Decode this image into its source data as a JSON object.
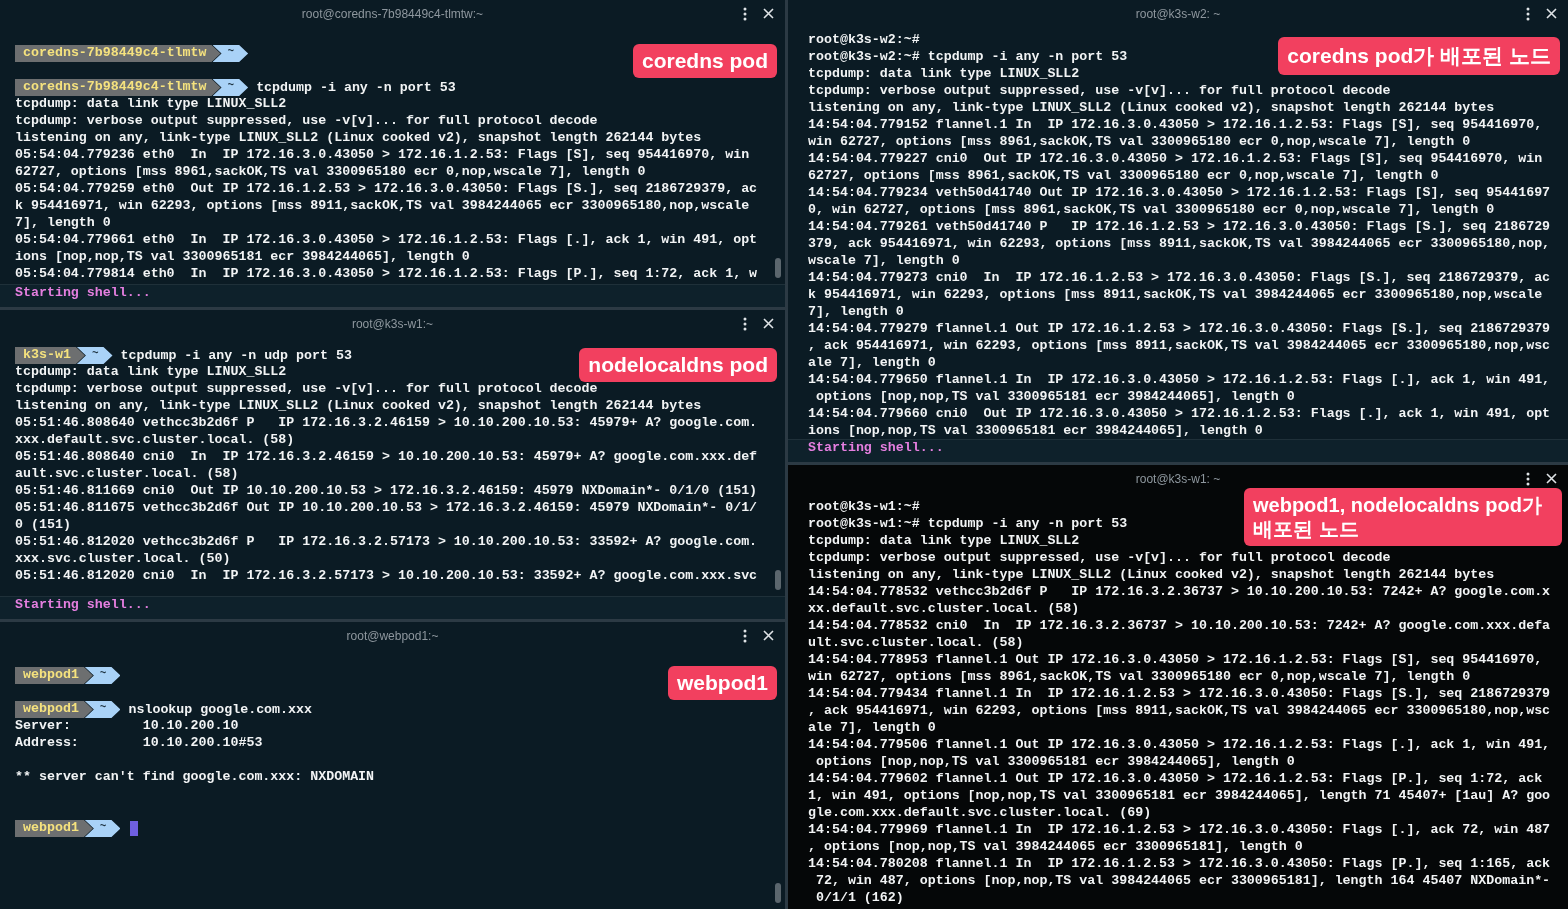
{
  "left_column": {
    "panes": [
      {
        "title": "root@coredns-7b98449c4-tlmtw:~",
        "label": "coredns pod",
        "status": "Starting shell...",
        "lines": [
          {
            "kind": "blank"
          },
          {
            "kind": "prompt",
            "host": "coredns-7b98449c4-tlmtw",
            "dir": "~"
          },
          {
            "kind": "blank"
          },
          {
            "kind": "prompt",
            "host": "coredns-7b98449c4-tlmtw",
            "dir": "~",
            "command": "tcpdump -i any -n port 53"
          },
          {
            "kind": "text",
            "text": "tcpdump: data link type LINUX_SLL2"
          },
          {
            "kind": "text",
            "text": "tcpdump: verbose output suppressed, use -v[v]... for full protocol decode"
          },
          {
            "kind": "text",
            "text": "listening on any, link-type LINUX_SLL2 (Linux cooked v2), snapshot length 262144 bytes"
          },
          {
            "kind": "text",
            "text": "05:54:04.779236 eth0  In  IP 172.16.3.0.43050 > 172.16.1.2.53: Flags [S], seq 954416970, win"
          },
          {
            "kind": "text",
            "text": "62727, options [mss 8961,sackOK,TS val 3300965180 ecr 0,nop,wscale 7], length 0"
          },
          {
            "kind": "text",
            "text": "05:54:04.779259 eth0  Out IP 172.16.1.2.53 > 172.16.3.0.43050: Flags [S.], seq 2186729379, ac"
          },
          {
            "kind": "text",
            "text": "k 954416971, win 62293, options [mss 8911,sackOK,TS val 3984244065 ecr 3300965180,nop,wscale"
          },
          {
            "kind": "text",
            "text": "7], length 0"
          },
          {
            "kind": "text",
            "text": "05:54:04.779661 eth0  In  IP 172.16.3.0.43050 > 172.16.1.2.53: Flags [.], ack 1, win 491, opt"
          },
          {
            "kind": "text",
            "text": "ions [nop,nop,TS val 3300965181 ecr 3984244065], length 0"
          },
          {
            "kind": "text",
            "text": "05:54:04.779814 eth0  In  IP 172.16.3.0.43050 > 172.16.1.2.53: Flags [P.], seq 1:72, ack 1, w"
          }
        ]
      },
      {
        "title": "root@k3s-w1:~",
        "label": "nodelocaldns pod",
        "status": "Starting shell...",
        "lines": [
          {
            "kind": "prompt",
            "host": "k3s-w1",
            "dir": "~",
            "command": "tcpdump -i any -n udp port 53"
          },
          {
            "kind": "text",
            "text": "tcpdump: data link type LINUX_SLL2"
          },
          {
            "kind": "text",
            "text": "tcpdump: verbose output suppressed, use -v[v]... for full protocol decode"
          },
          {
            "kind": "text",
            "text": "listening on any, link-type LINUX_SLL2 (Linux cooked v2), snapshot length 262144 bytes"
          },
          {
            "kind": "text",
            "text": "05:51:46.808640 vethcc3b2d6f P   IP 172.16.3.2.46159 > 10.10.200.10.53: 45979+ A? google.com."
          },
          {
            "kind": "text",
            "text": "xxx.default.svc.cluster.local. (58)"
          },
          {
            "kind": "text",
            "text": "05:51:46.808640 cni0  In  IP 172.16.3.2.46159 > 10.10.200.10.53: 45979+ A? google.com.xxx.def"
          },
          {
            "kind": "text",
            "text": "ault.svc.cluster.local. (58)"
          },
          {
            "kind": "text",
            "text": "05:51:46.811669 cni0  Out IP 10.10.200.10.53 > 172.16.3.2.46159: 45979 NXDomain*- 0/1/0 (151)"
          },
          {
            "kind": "text",
            "text": "05:51:46.811675 vethcc3b2d6f Out IP 10.10.200.10.53 > 172.16.3.2.46159: 45979 NXDomain*- 0/1/"
          },
          {
            "kind": "text",
            "text": "0 (151)"
          },
          {
            "kind": "text",
            "text": "05:51:46.812020 vethcc3b2d6f P   IP 172.16.3.2.57173 > 10.10.200.10.53: 33592+ A? google.com."
          },
          {
            "kind": "text",
            "text": "xxx.svc.cluster.local. (50)"
          },
          {
            "kind": "text",
            "text": "05:51:46.812020 cni0  In  IP 172.16.3.2.57173 > 10.10.200.10.53: 33592+ A? google.com.xxx.svc"
          }
        ]
      },
      {
        "title": "root@webpod1:~",
        "label": "webpod1",
        "lines": [
          {
            "kind": "blank"
          },
          {
            "kind": "prompt",
            "host": "webpod1",
            "dir": "~"
          },
          {
            "kind": "blank"
          },
          {
            "kind": "prompt",
            "host": "webpod1",
            "dir": "~",
            "command": "nslookup google.com.xxx"
          },
          {
            "kind": "text",
            "text": "Server:         10.10.200.10"
          },
          {
            "kind": "text",
            "text": "Address:        10.10.200.10#53"
          },
          {
            "kind": "blank"
          },
          {
            "kind": "text",
            "text": "** server can't find google.com.xxx: NXDOMAIN"
          },
          {
            "kind": "blank"
          },
          {
            "kind": "blank"
          },
          {
            "kind": "prompt",
            "host": "webpod1",
            "dir": "~",
            "cursor": true
          }
        ]
      }
    ]
  },
  "right_column": {
    "panes": [
      {
        "title": "root@k3s-w2: ~",
        "label": "coredns pod가 배포된 노드",
        "status": "Starting shell...",
        "lines": [
          {
            "kind": "text",
            "text": "root@k3s-w2:~#"
          },
          {
            "kind": "text",
            "text": "root@k3s-w2:~# tcpdump -i any -n port 53"
          },
          {
            "kind": "text",
            "text": "tcpdump: data link type LINUX_SLL2"
          },
          {
            "kind": "text",
            "text": "tcpdump: verbose output suppressed, use -v[v]... for full protocol decode"
          },
          {
            "kind": "text",
            "text": "listening on any, link-type LINUX_SLL2 (Linux cooked v2), snapshot length 262144 bytes"
          },
          {
            "kind": "text",
            "text": "14:54:04.779152 flannel.1 In  IP 172.16.3.0.43050 > 172.16.1.2.53: Flags [S], seq 954416970,"
          },
          {
            "kind": "text",
            "text": "win 62727, options [mss 8961,sackOK,TS val 3300965180 ecr 0,nop,wscale 7], length 0"
          },
          {
            "kind": "text",
            "text": "14:54:04.779227 cni0  Out IP 172.16.3.0.43050 > 172.16.1.2.53: Flags [S], seq 954416970, win"
          },
          {
            "kind": "text",
            "text": "62727, options [mss 8961,sackOK,TS val 3300965180 ecr 0,nop,wscale 7], length 0"
          },
          {
            "kind": "text",
            "text": "14:54:04.779234 veth50d41740 Out IP 172.16.3.0.43050 > 172.16.1.2.53: Flags [S], seq 95441697"
          },
          {
            "kind": "text",
            "text": "0, win 62727, options [mss 8961,sackOK,TS val 3300965180 ecr 0,nop,wscale 7], length 0"
          },
          {
            "kind": "text",
            "text": "14:54:04.779261 veth50d41740 P   IP 172.16.1.2.53 > 172.16.3.0.43050: Flags [S.], seq 2186729"
          },
          {
            "kind": "text",
            "text": "379, ack 954416971, win 62293, options [mss 8911,sackOK,TS val 3984244065 ecr 3300965180,nop,"
          },
          {
            "kind": "text",
            "text": "wscale 7], length 0"
          },
          {
            "kind": "text",
            "text": "14:54:04.779273 cni0  In  IP 172.16.1.2.53 > 172.16.3.0.43050: Flags [S.], seq 2186729379, ac"
          },
          {
            "kind": "text",
            "text": "k 954416971, win 62293, options [mss 8911,sackOK,TS val 3984244065 ecr 3300965180,nop,wscale"
          },
          {
            "kind": "text",
            "text": "7], length 0"
          },
          {
            "kind": "text",
            "text": "14:54:04.779279 flannel.1 Out IP 172.16.1.2.53 > 172.16.3.0.43050: Flags [S.], seq 2186729379"
          },
          {
            "kind": "text",
            "text": ", ack 954416971, win 62293, options [mss 8911,sackOK,TS val 3984244065 ecr 3300965180,nop,wsc"
          },
          {
            "kind": "text",
            "text": "ale 7], length 0"
          },
          {
            "kind": "text",
            "text": "14:54:04.779650 flannel.1 In  IP 172.16.3.0.43050 > 172.16.1.2.53: Flags [.], ack 1, win 491,"
          },
          {
            "kind": "text",
            "text": " options [nop,nop,TS val 3300965181 ecr 3984244065], length 0"
          },
          {
            "kind": "text",
            "text": "14:54:04.779660 cni0  Out IP 172.16.3.0.43050 > 172.16.1.2.53: Flags [.], ack 1, win 491, opt"
          },
          {
            "kind": "text",
            "text": "ions [nop,nop,TS val 3300965181 ecr 3984244065], length 0"
          }
        ]
      },
      {
        "title": "root@k3s-w1: ~",
        "label": "webpod1, nodelocaldns pod가 배포된 노드",
        "lines": [
          {
            "kind": "text",
            "text": "root@k3s-w1:~#"
          },
          {
            "kind": "text",
            "text": "root@k3s-w1:~# tcpdump -i any -n port 53"
          },
          {
            "kind": "text",
            "text": "tcpdump: data link type LINUX_SLL2"
          },
          {
            "kind": "text",
            "text": "tcpdump: verbose output suppressed, use -v[v]... for full protocol decode"
          },
          {
            "kind": "text",
            "text": "listening on any, link-type LINUX_SLL2 (Linux cooked v2), snapshot length 262144 bytes"
          },
          {
            "kind": "text",
            "text": "14:54:04.778532 vethcc3b2d6f P   IP 172.16.3.2.36737 > 10.10.200.10.53: 7242+ A? google.com.x"
          },
          {
            "kind": "text",
            "text": "xx.default.svc.cluster.local. (58)"
          },
          {
            "kind": "text",
            "text": "14:54:04.778532 cni0  In  IP 172.16.3.2.36737 > 10.10.200.10.53: 7242+ A? google.com.xxx.defa"
          },
          {
            "kind": "text",
            "text": "ult.svc.cluster.local. (58)"
          },
          {
            "kind": "text",
            "text": "14:54:04.778953 flannel.1 Out IP 172.16.3.0.43050 > 172.16.1.2.53: Flags [S], seq 954416970,"
          },
          {
            "kind": "text",
            "text": "win 62727, options [mss 8961,sackOK,TS val 3300965180 ecr 0,nop,wscale 7], length 0"
          },
          {
            "kind": "text",
            "text": "14:54:04.779434 flannel.1 In  IP 172.16.1.2.53 > 172.16.3.0.43050: Flags [S.], seq 2186729379"
          },
          {
            "kind": "text",
            "text": ", ack 954416971, win 62293, options [mss 8911,sackOK,TS val 3984244065 ecr 3300965180,nop,wsc"
          },
          {
            "kind": "text",
            "text": "ale 7], length 0"
          },
          {
            "kind": "text",
            "text": "14:54:04.779506 flannel.1 Out IP 172.16.3.0.43050 > 172.16.1.2.53: Flags [.], ack 1, win 491,"
          },
          {
            "kind": "text",
            "text": " options [nop,nop,TS val 3300965181 ecr 3984244065], length 0"
          },
          {
            "kind": "text",
            "text": "14:54:04.779602 flannel.1 Out IP 172.16.3.0.43050 > 172.16.1.2.53: Flags [P.], seq 1:72, ack"
          },
          {
            "kind": "text",
            "text": "1, win 491, options [nop,nop,TS val 3300965181 ecr 3984244065], length 71 45407+ [1au] A? goo"
          },
          {
            "kind": "text",
            "text": "gle.com.xxx.default.svc.cluster.local. (69)"
          },
          {
            "kind": "text",
            "text": "14:54:04.779969 flannel.1 In  IP 172.16.1.2.53 > 172.16.3.0.43050: Flags [.], ack 72, win 487"
          },
          {
            "kind": "text",
            "text": ", options [nop,nop,TS val 3984244065 ecr 3300965181], length 0"
          },
          {
            "kind": "text",
            "text": "14:54:04.780208 flannel.1 In  IP 172.16.1.2.53 > 172.16.3.0.43050: Flags [P.], seq 1:165, ack"
          },
          {
            "kind": "text",
            "text": " 72, win 487, options [nop,nop,TS val 3984244065 ecr 3300965181], length 164 45407 NXDomain*-"
          },
          {
            "kind": "text",
            "text": " 0/1/1 (162)"
          }
        ]
      }
    ]
  }
}
